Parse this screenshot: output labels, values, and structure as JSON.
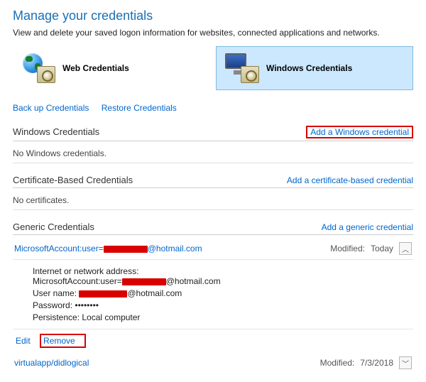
{
  "header": {
    "title": "Manage your credentials",
    "subtitle": "View and delete your saved logon information for websites, connected applications and networks."
  },
  "tiles": {
    "web": "Web Credentials",
    "windows": "Windows Credentials"
  },
  "links": {
    "backup": "Back up Credentials",
    "restore": "Restore Credentials"
  },
  "sections": {
    "windows": {
      "name": "Windows Credentials",
      "add": "Add a Windows credential",
      "empty": "No Windows credentials."
    },
    "cert": {
      "name": "Certificate-Based Credentials",
      "add": "Add a certificate-based credential",
      "empty": "No certificates."
    },
    "generic": {
      "name": "Generic Credentials",
      "add": "Add a generic credential"
    }
  },
  "credential_expanded": {
    "name_prefix": "MicrosoftAccount:user=",
    "name_suffix": "@hotmail.com",
    "modified_label": "Modified:",
    "modified_value": "Today",
    "addr_label": "Internet or network address:",
    "addr_prefix": "MicrosoftAccount:user=",
    "addr_suffix": "@hotmail.com",
    "user_label": "User name:",
    "user_suffix": "@hotmail.com",
    "pass_label": "Password:",
    "pass_value": "••••••••",
    "persist_label": "Persistence:",
    "persist_value": "Local computer",
    "edit": "Edit",
    "remove": "Remove"
  },
  "credential_collapsed": {
    "name": "virtualapp/didlogical",
    "modified_label": "Modified:",
    "modified_value": "7/3/2018"
  }
}
